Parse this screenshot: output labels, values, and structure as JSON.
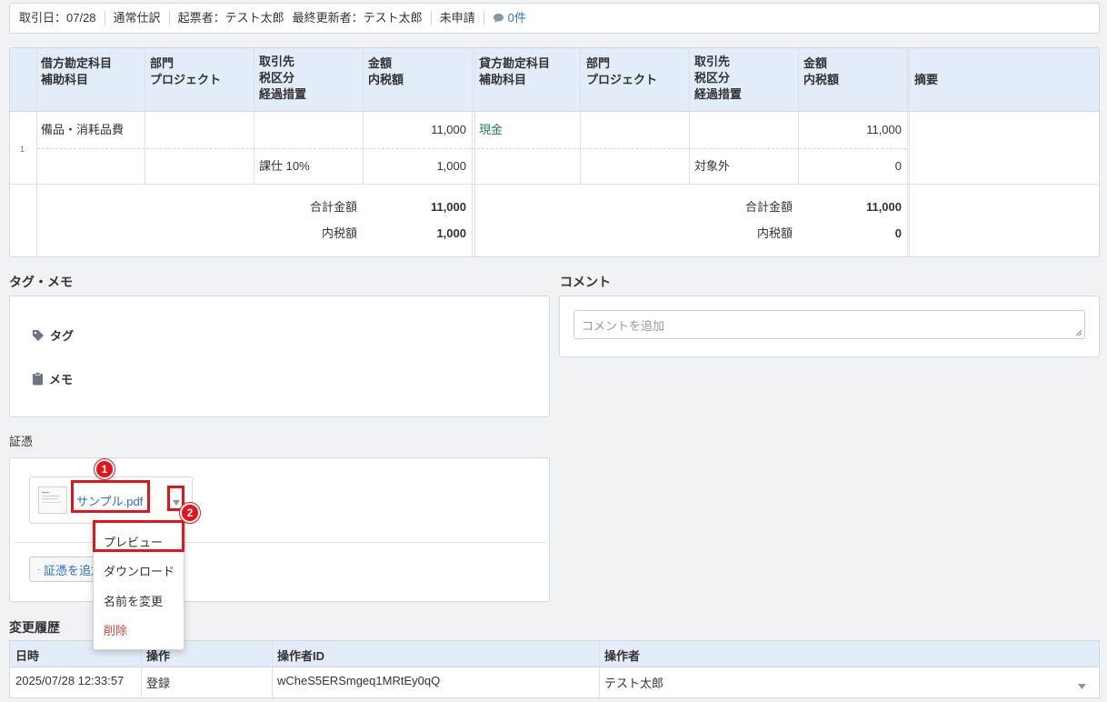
{
  "info_bar": {
    "date": "取引日：07/28",
    "type": "通常仕訳",
    "creator": "起票者：テスト太郎",
    "updater": "最終更新者：テスト太郎",
    "status": "未申請",
    "comment_count": "0件"
  },
  "journal": {
    "debit_headers": {
      "account": [
        "借方勘定科目",
        "補助科目"
      ],
      "department": [
        "部門",
        "プロジェクト"
      ],
      "partner": [
        "取引先",
        "税区分",
        "経過措置"
      ],
      "amount": [
        "金額",
        "内税額"
      ]
    },
    "credit_headers": {
      "account": [
        "貸方勘定科目",
        "補助科目"
      ],
      "department": [
        "部門",
        "プロジェクト"
      ],
      "partner": [
        "取引先",
        "税区分",
        "経過措置"
      ],
      "amount": [
        "金額",
        "内税額"
      ]
    },
    "memo_header": "摘要",
    "rows": [
      {
        "no": "1",
        "debit_account": "備品・消耗品費",
        "debit_amount": "11,000",
        "debit_tax_class": "課仕 10%",
        "debit_tax": "1,000",
        "credit_account": "現金",
        "credit_amount": "11,000",
        "credit_tax_class": "対象外",
        "credit_tax": "0"
      }
    ],
    "totals": {
      "total_label": "合計金額",
      "tax_label": "内税額",
      "debit_total": "11,000",
      "debit_tax_total": "1,000",
      "credit_total": "11,000",
      "credit_tax_total": "0"
    }
  },
  "tag_memo": {
    "title": "タグ・メモ",
    "tag_label": "タグ",
    "memo_label": "メモ"
  },
  "comment": {
    "title": "コメント",
    "placeholder": "コメントを追加"
  },
  "evidence": {
    "title": "証憑",
    "file_name": "サンプル.pdf",
    "add_button": "証憑を追加",
    "menu": [
      "プレビュー",
      "ダウンロード",
      "名前を変更",
      "削除"
    ]
  },
  "annotations": [
    "1",
    "2"
  ],
  "history": {
    "title": "変更履歴",
    "columns": [
      "日時",
      "操作",
      "操作者ID",
      "操作者"
    ],
    "rows": [
      {
        "datetime": "2025/07/28 12:33:57",
        "operation": "登録",
        "operator_id": "wCheS5ERSmgeq1MRtEy0qQ",
        "operator": "テスト太郎"
      }
    ]
  },
  "colors": {
    "link": "#2e6ecf",
    "account_green": "#247a4f",
    "danger": "#d9433a",
    "header_bg": "#e3edf9",
    "annotation_red": "#e3141b"
  }
}
